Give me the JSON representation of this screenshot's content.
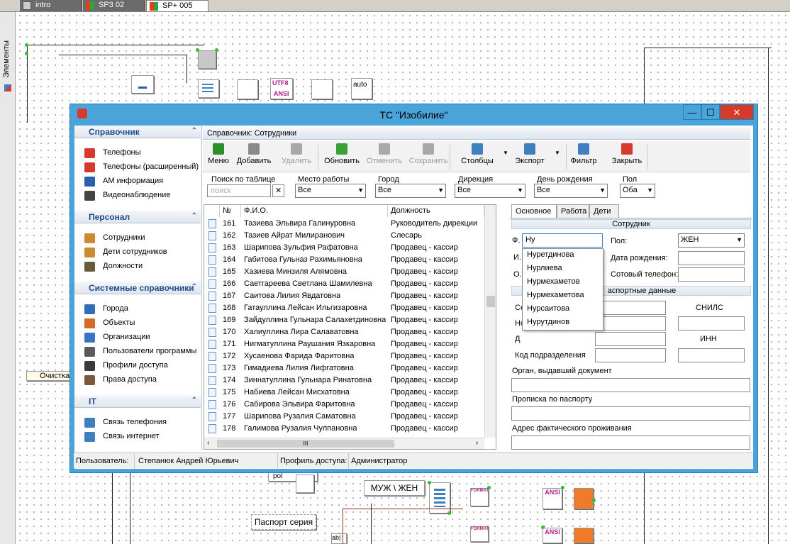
{
  "top_tabs": [
    "intro",
    "SP3 02",
    "SP+ 005"
  ],
  "left_strip": {
    "label": "Элементы"
  },
  "canvas": {
    "clear_label": "Очистка",
    "sex_label": "МУЖ \\ ЖЕН",
    "passport_series": "Паспорт серия",
    "pol": "pol",
    "utf8_ansi": "UTF8",
    "ansi": "ANSI",
    "auto": "auto",
    "format": "FORMAT",
    "ab": "ab|"
  },
  "window": {
    "title": "ТС \"Изобилие\"",
    "buttons": {
      "minimize": "—",
      "maximize": "☐",
      "close": "✕"
    },
    "groups": [
      {
        "title": "Справочник",
        "items": [
          {
            "label": "Телефоны",
            "color": "#d63a2c"
          },
          {
            "label": "Телефоны (расширенный)",
            "color": "#d63a2c"
          },
          {
            "label": "АМ информация",
            "color": "#2a5fae"
          },
          {
            "label": "Видеонаблюдение",
            "color": "#444444"
          }
        ]
      },
      {
        "title": "Персонал",
        "items": [
          {
            "label": "Сотрудники",
            "color": "#c98c30"
          },
          {
            "label": "Дети сотрудников",
            "color": "#c98c30"
          },
          {
            "label": "Должности",
            "color": "#6b5a3a"
          }
        ]
      },
      {
        "title": "Системные справочники",
        "items": [
          {
            "label": "Города",
            "color": "#2f6db5"
          },
          {
            "label": "Объекты",
            "color": "#d46a2a"
          },
          {
            "label": "Организации",
            "color": "#3a73c2"
          },
          {
            "label": "Пользователи программы",
            "color": "#5a5a5a"
          },
          {
            "label": "Профили доступа",
            "color": "#3a3a3a"
          },
          {
            "label": "Права доступа",
            "color": "#7a5a3a"
          }
        ]
      },
      {
        "title": "IT",
        "items": [
          {
            "label": "Связь телефония",
            "color": "#3f7fbf"
          },
          {
            "label": "Связь интернет",
            "color": "#3f7fbf"
          }
        ]
      }
    ],
    "header": "Справочник: Сотрудники",
    "toolbar": [
      {
        "label": "Меню",
        "enabled": true,
        "color": "#2a8f2a"
      },
      {
        "label": "Добавить",
        "enabled": true,
        "color": "#8a8a8a"
      },
      {
        "label": "Удалить",
        "enabled": false,
        "color": "#a8a8a8"
      },
      {
        "label": "Обновить",
        "enabled": true,
        "color": "#3aa03a"
      },
      {
        "label": "Отменить",
        "enabled": false,
        "color": "#a8a8a8"
      },
      {
        "label": "Сохранить",
        "enabled": false,
        "color": "#a8a8a8"
      },
      {
        "label": "Столбцы",
        "enabled": true,
        "color": "#3f7fbf"
      },
      {
        "label": "Экспорт",
        "enabled": true,
        "color": "#3f7fbf"
      },
      {
        "label": "Фильтр",
        "enabled": true,
        "color": "#3f7fbf"
      },
      {
        "label": "Закрыть",
        "enabled": true,
        "color": "#d63a2c"
      }
    ],
    "filters": {
      "search_label": "Поиск по таблице",
      "search_placeholder": "поиск",
      "clear": "✕",
      "work_place": {
        "label": "Место работы",
        "value": "Все"
      },
      "city": {
        "label": "Город",
        "value": "Все"
      },
      "directorate": {
        "label": "Дирекция",
        "value": "Все"
      },
      "birthday": {
        "label": "День рождения",
        "value": "Все"
      },
      "sex": {
        "label": "Пол",
        "value": "Оба"
      }
    },
    "table": {
      "columns": [
        "№",
        "Ф.И.О.",
        "Должность"
      ],
      "rows": [
        [
          "161",
          "Тазиева Эльвира Галинуровна",
          "Руководитель дирекции"
        ],
        [
          "162",
          "Тазиев  Айрат Милиранович",
          "Слесарь"
        ],
        [
          "163",
          "Шарипова Зульфия Рафатовна",
          "Продавец - кассир"
        ],
        [
          "164",
          "Габитова Гульназ Рахимьяновна",
          "Продавец - кассир"
        ],
        [
          "165",
          "Хазиева Минзиля Алямовна",
          "Продавец - кассир"
        ],
        [
          "166",
          "Саетгареева Светлана Шамилевна",
          "Продавец - кассир"
        ],
        [
          "167",
          "Саитова Лилия Явдатовна",
          "Продавец - кассир"
        ],
        [
          "168",
          "Гатауллина Лейсан Ильгизаровна",
          "Продавец - кассир"
        ],
        [
          "169",
          "Зайдуллина Гульнара Салахетдиновна",
          "Продавец - кассир"
        ],
        [
          "170",
          "Халиуллина Лира Салаватовна",
          "Продавец - кассир"
        ],
        [
          "171",
          "Нигматуллина Раушания Язкаровна",
          "Продавец - кассир"
        ],
        [
          "172",
          "Хусаенова Фарида Фаритовна",
          "Продавец - кассир"
        ],
        [
          "173",
          "Гимадиева Лилия Лифгатовна",
          "Продавец - кассир"
        ],
        [
          "174",
          "Зиннатуллина Гульнара Ринатовна",
          "Продавец - кассир"
        ],
        [
          "175",
          "Набиева Лейсан Мисхатовна",
          "Продавец - кассир"
        ],
        [
          "176",
          "Сабирова Эльвира Фаритовна",
          "Продавец - кассир"
        ],
        [
          "177",
          "Шарипова Рузалия Саматовна",
          "Продавец - кассир"
        ],
        [
          "178",
          "Галимова Рузалия Чулпановна",
          "Продавец - кассир"
        ]
      ],
      "hscroll": "III"
    },
    "form": {
      "tabs": [
        "Основное",
        "Работа",
        "Дети"
      ],
      "section_employee": "Сотрудник",
      "f_label": "Ф.",
      "f_value": "Ну",
      "i_label": "И.",
      "o_label": "О.",
      "sex_label": "Пол:",
      "sex_value": "ЖЕН",
      "birth_label": "Дата рождения:",
      "mobile_label": "Сотовый телефон:",
      "section_passport": "аспортные данные",
      "se_label": "Се",
      "no_label": "Но",
      "da_label": "Д",
      "snils_label": "СНИЛС",
      "inn_label": "ИНН",
      "code_label": "Код подразделения",
      "issued_label": "Орган, выдавший документ",
      "reg_label": "Прописка по паспорту",
      "addr_label": "Адрес фактического проживания",
      "autocomplete": [
        "Нуретдинова",
        "Нурлиева",
        "Нурмехаметов",
        "Нурмехаметова",
        "Нурсаитова",
        "Нурутдинов"
      ]
    },
    "status": {
      "user_label": "Пользователь:",
      "user": "Степанюк Андрей Юрьевич",
      "profile_label": "Профиль доступа:",
      "profile": "Администратор"
    }
  }
}
